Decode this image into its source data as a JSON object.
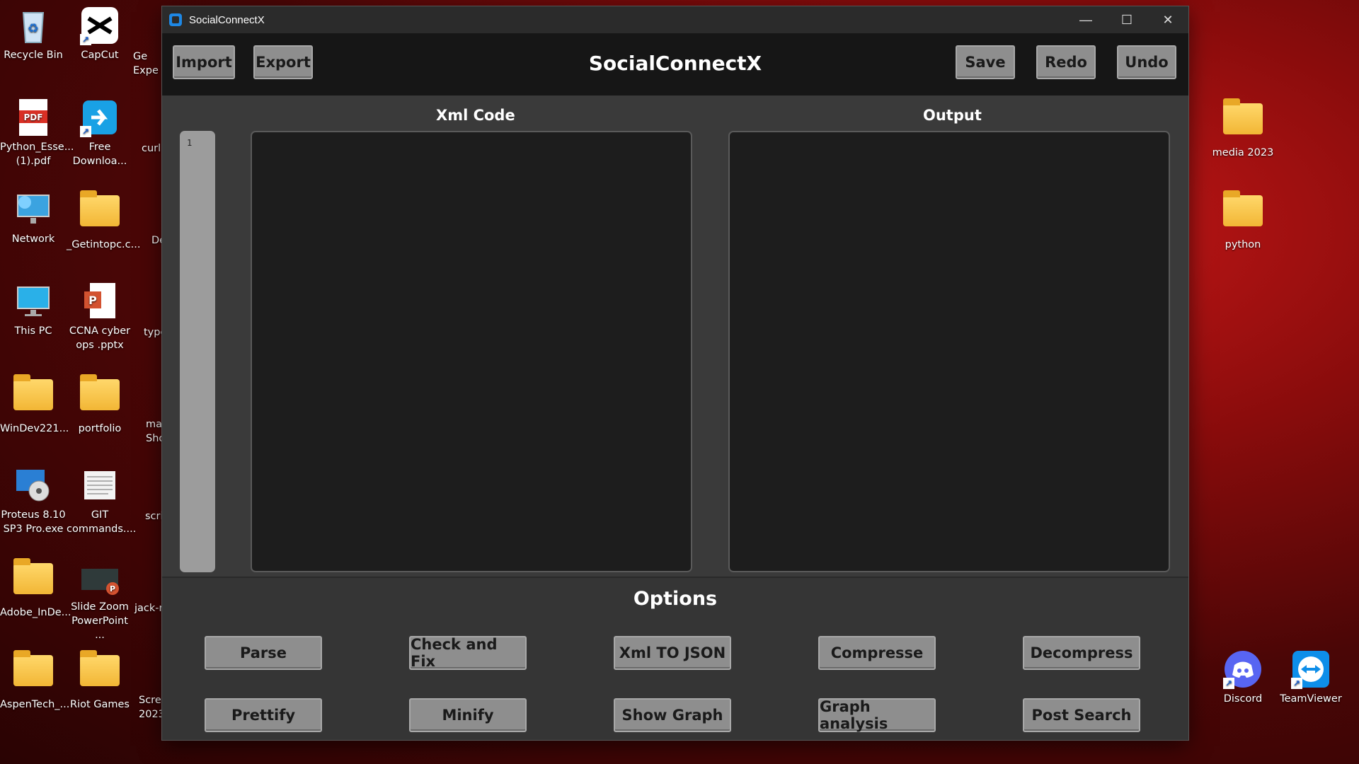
{
  "desktop_left": [
    {
      "label": "Recycle Bin",
      "icon": "recycle-bin-icon"
    },
    {
      "label": "CapCut",
      "icon": "capcut-icon"
    },
    {
      "label": "Python_Esse... (1).pdf",
      "icon": "pdf-icon"
    },
    {
      "label": "Free Downloa...",
      "icon": "download-icon"
    },
    {
      "label": "Network",
      "icon": "network-icon"
    },
    {
      "label": "_Getintopc.c...",
      "icon": "folder-icon"
    },
    {
      "label": "This PC",
      "icon": "monitor-icon"
    },
    {
      "label": "CCNA cyber ops .pptx",
      "icon": "pptx-icon"
    },
    {
      "label": "WinDev221...",
      "icon": "folder-icon"
    },
    {
      "label": "portfolio",
      "icon": "folder-icon"
    },
    {
      "label": "Proteus 8.10 SP3 Pro.exe",
      "icon": "installer-icon"
    },
    {
      "label": "GIT commands....",
      "icon": "document-icon"
    },
    {
      "label": "Adobe_InDe...",
      "icon": "folder-icon"
    },
    {
      "label": "Slide Zoom PowerPoint ...",
      "icon": "pptx-icon"
    },
    {
      "label": "AspenTech_...",
      "icon": "folder-icon"
    },
    {
      "label": "Riot Games",
      "icon": "folder-icon"
    }
  ],
  "desktop_partial": [
    "Ge Expe",
    "curl",
    "De",
    "type",
    "ma Sho",
    "scri",
    "jack-r",
    "Scre 2023"
  ],
  "desktop_right": [
    {
      "label": "media 2023",
      "icon": "folder-icon"
    },
    {
      "label": "python",
      "icon": "folder-icon"
    },
    {
      "label": "Discord",
      "icon": "discord-icon"
    },
    {
      "label": "TeamViewer",
      "icon": "teamviewer-icon"
    }
  ],
  "window": {
    "title": "SocialConnectX",
    "controls": {
      "minimize": "—",
      "maximize": "☐",
      "close": "✕"
    }
  },
  "toolbar": {
    "import_label": "Import",
    "export_label": "Export",
    "app_title": "SocialConnectX",
    "save_label": "Save",
    "redo_label": "Redo",
    "undo_label": "Undo"
  },
  "editor": {
    "xml_title": "Xml Code",
    "output_title": "Output",
    "line_number": "1",
    "xml_content": "",
    "output_content": ""
  },
  "options": {
    "title": "Options",
    "row1": [
      "Parse",
      "Check and Fix",
      "Xml TO JSON",
      "Compresse",
      "Decompress"
    ],
    "row2": [
      "Prettify",
      "Minify",
      "Show Graph",
      "Graph analysis",
      "Post Search"
    ]
  }
}
